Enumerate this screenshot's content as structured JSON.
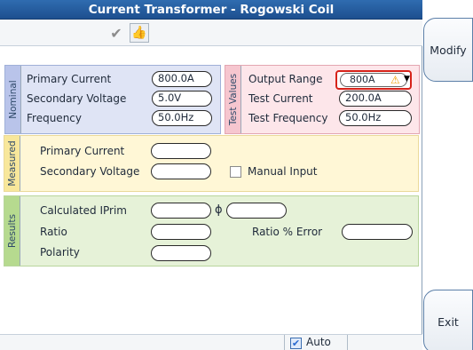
{
  "title": "Current Transformer - Rogowski Coil",
  "toolbar": {
    "check_icon": "check-icon",
    "thumb_icon": "thumbs-up-icon"
  },
  "nominal": {
    "tab_label": "Nominal",
    "primary_current_label": "Primary Current",
    "primary_current_value": "800.0A",
    "secondary_voltage_label": "Secondary Voltage",
    "secondary_voltage_value": "5.0V",
    "frequency_label": "Frequency",
    "frequency_value": "50.0Hz"
  },
  "test_values": {
    "tab_label": "Test Values",
    "output_range_label": "Output Range",
    "output_range_value": "800A",
    "test_current_label": "Test Current",
    "test_current_value": "200.0A",
    "test_frequency_label": "Test Frequency",
    "test_frequency_value": "50.0Hz"
  },
  "measured": {
    "tab_label": "Measured",
    "primary_current_label": "Primary Current",
    "primary_current_value": "",
    "secondary_voltage_label": "Secondary Voltage",
    "secondary_voltage_value": "",
    "manual_input_label": "Manual Input",
    "manual_input_checked": false
  },
  "results": {
    "tab_label": "Results",
    "calculated_iprim_label": "Calculated IPrim",
    "calculated_iprim_value": "",
    "phase_symbol": "ϕ",
    "phase_value": "",
    "ratio_label": "Ratio",
    "ratio_value": "",
    "ratio_error_label": "Ratio % Error",
    "ratio_error_value": "",
    "polarity_label": "Polarity",
    "polarity_value": ""
  },
  "bottom": {
    "auto_label": "Auto",
    "auto_checked": true
  },
  "side": {
    "modify_label": "Modify",
    "exit_label": "Exit"
  },
  "colors": {
    "title_bar": "#1d4f8f",
    "nominal_bg": "#dfe4f5",
    "test_values_bg": "#fde6ea",
    "measured_bg": "#fff7d6",
    "results_bg": "#e6f2d8",
    "warning": "#f0a000",
    "highlight_border": "#d6231a"
  }
}
